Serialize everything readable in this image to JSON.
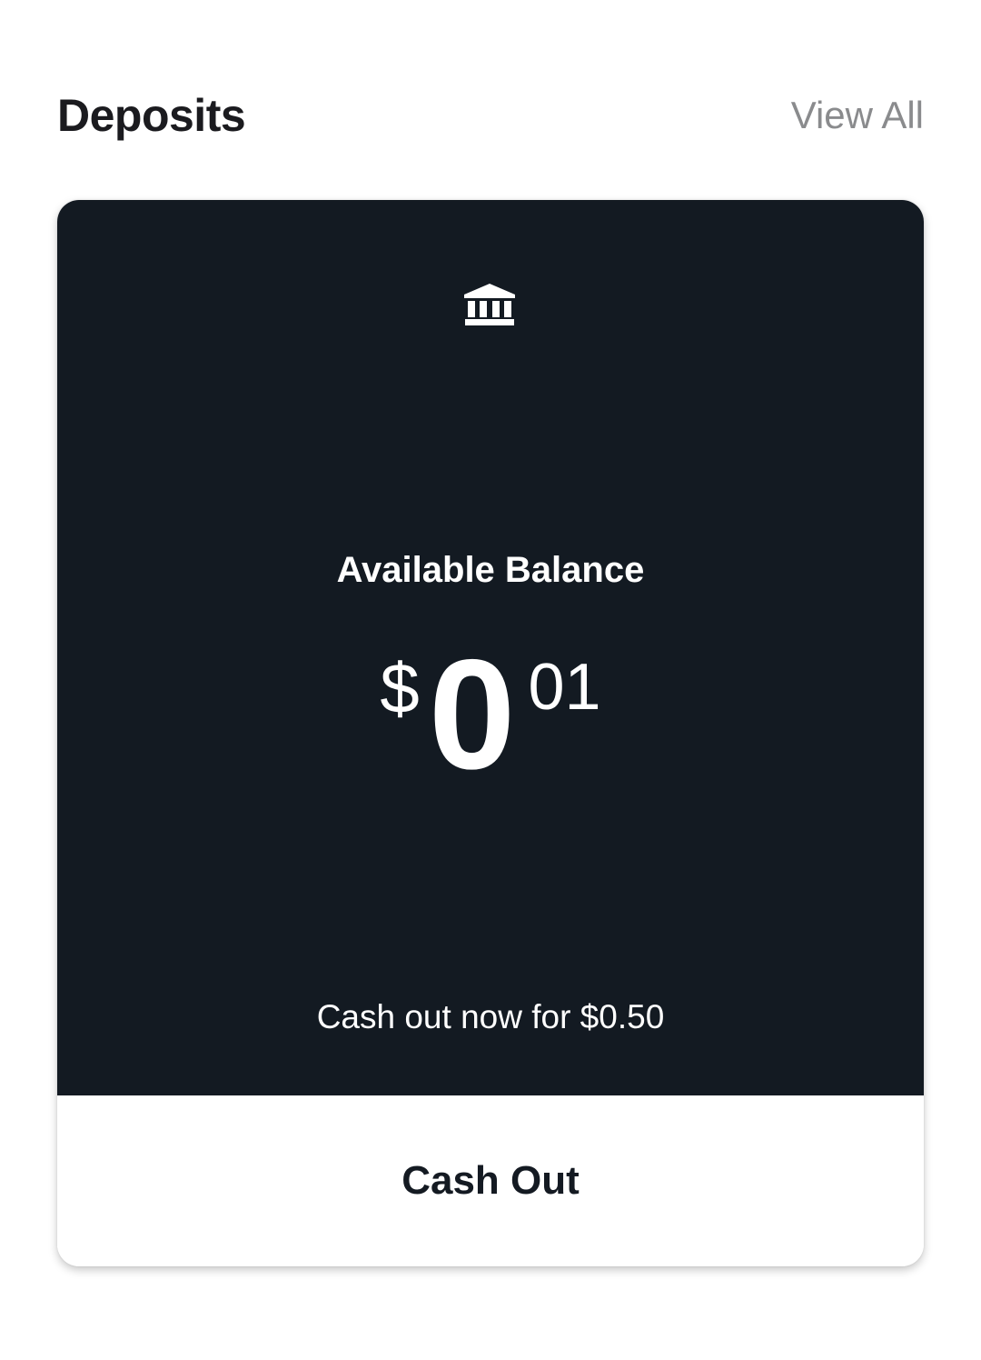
{
  "header": {
    "title": "Deposits",
    "view_all_label": "View All"
  },
  "card": {
    "icon": "bank-icon",
    "balance_label": "Available Balance",
    "amount": {
      "currency": "$",
      "whole": "0",
      "cents": "01"
    },
    "cashout_note": "Cash out now for $0.50",
    "cashout_button_label": "Cash Out"
  },
  "colors": {
    "card_background": "#131a22",
    "text_primary": "#1b1b1f",
    "text_muted": "#8a8b8d",
    "white": "#ffffff"
  }
}
